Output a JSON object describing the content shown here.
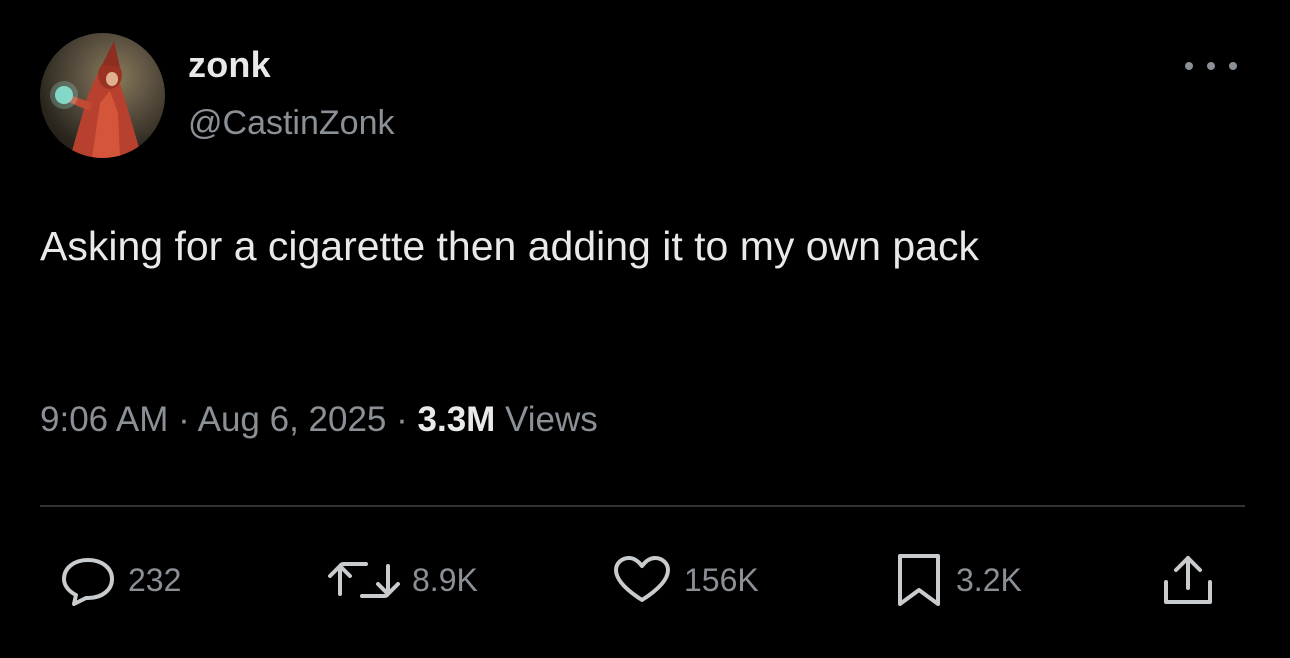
{
  "author": {
    "display_name": "zonk",
    "handle": "@CastinZonk",
    "avatar_icon": "wizard-avatar"
  },
  "tweet": {
    "text": "Asking for a cigarette then adding it to my own pack",
    "time": "9:06 AM",
    "separator": " · ",
    "date": "Aug 6, 2025",
    "views_count": "3.3M",
    "views_label": "Views"
  },
  "actions": {
    "replies": "232",
    "retweets": "8.9K",
    "likes": "156K",
    "bookmarks": "3.2K"
  },
  "colors": {
    "background": "#000000",
    "primary_text": "#e7e9ea",
    "secondary_text": "#8b9096",
    "divider": "#2f3336"
  }
}
